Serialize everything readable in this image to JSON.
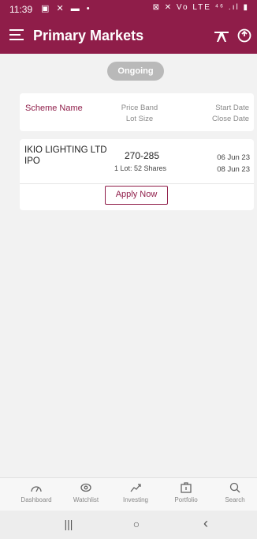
{
  "status_bar": {
    "time": "11:39",
    "left_icons": "▣ ✕ ▬ •",
    "right_icons": "⊠ ✕ Vo LTE ⁴⁶ .ıl ▮"
  },
  "app_bar": {
    "menu_icon": "hamburger-menu-icon",
    "title": "Primary Markets",
    "action_icons": [
      "ipo-flight-icon",
      "refresh-icon"
    ]
  },
  "tabs": {
    "active": "Ongoing"
  },
  "table_header": {
    "scheme_name": "Scheme Name",
    "price_band": "Price Band",
    "lot_size": "Lot Size",
    "start_date": "Start Date",
    "close_date": "Close Date"
  },
  "ipos": [
    {
      "name": "IKIO LIGHTING LTD IPO",
      "price_band": "270-285",
      "lot": "1 Lot: 52 Shares",
      "start_date": "06 Jun 23",
      "close_date": "08 Jun 23",
      "action": "Apply Now"
    }
  ],
  "bottom_nav": [
    {
      "label": "Dashboard",
      "icon": "gauge-icon"
    },
    {
      "label": "Watchlist",
      "icon": "eye-icon"
    },
    {
      "label": "Investing",
      "icon": "trend-icon"
    },
    {
      "label": "Portfolio",
      "icon": "briefcase-icon"
    },
    {
      "label": "Search",
      "icon": "search-icon"
    }
  ],
  "system_nav": {
    "recents": "|||",
    "home": "○",
    "back": "‹"
  },
  "colors": {
    "brand": "#8f1d49",
    "tab_inactive": "#b9b9b9",
    "background": "#f2f2f2"
  }
}
